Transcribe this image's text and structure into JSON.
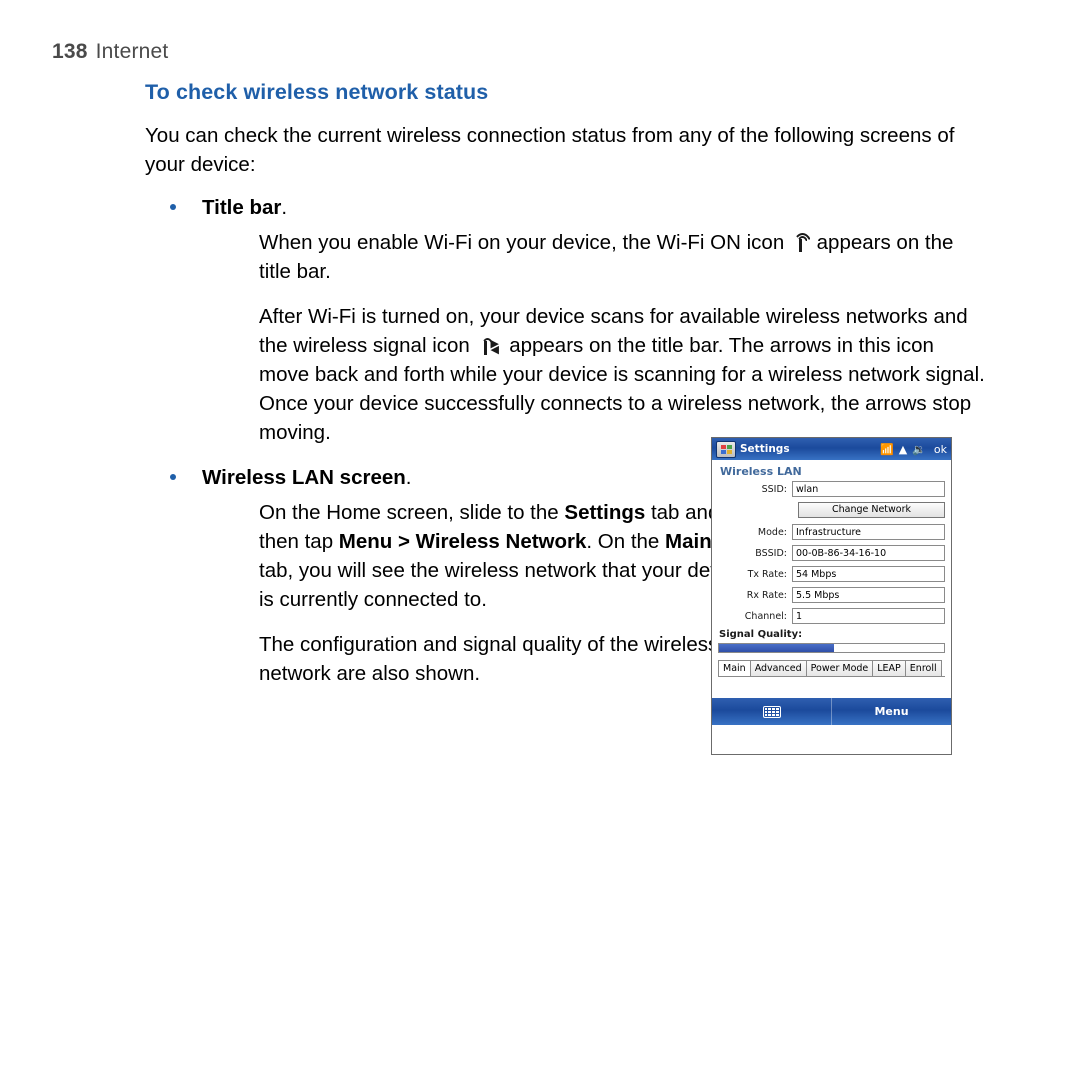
{
  "header": {
    "page_number": "138",
    "chapter": "Internet"
  },
  "section": {
    "title": "To check wireless network status",
    "intro": "You can check the current wireless connection status from any of the following screens of your device:"
  },
  "bullets": [
    {
      "head_bold": "Title bar",
      "head_rest": ".",
      "paragraphs": [
        "When you enable Wi-Fi on your device, the Wi-Fi ON icon  appears on the title bar.",
        "After Wi-Fi is turned on, your device scans for available wireless networks and the wireless signal icon  appears on the title bar. The arrows in this icon move back and forth while your device is scanning for a wireless network signal. Once your device successfully connects to a wireless network, the arrows stop moving."
      ]
    },
    {
      "head_bold": "Wireless LAN screen",
      "head_rest": ".",
      "paragraphs": [
        "On the Home screen, slide to the Settings tab and then tap Menu > Wireless Network. On the Main tab, you will see the wireless network that your device is currently connected to.",
        "The configuration and signal quality of the wireless network are also shown."
      ]
    }
  ],
  "para2_parts": {
    "p1a": "When you enable Wi-Fi on your device, the Wi-Fi ON icon",
    "p1b": "appears on the title bar.",
    "p2a": "After Wi-Fi is turned on, your device scans for available wireless networks and the wireless signal icon",
    "p2b": "appears on the title bar. The arrows in this icon move back and forth while your device is scanning for a wireless network signal. Once your device successfully connects to a wireless network, the arrows stop moving."
  },
  "para3_parts": {
    "a": "On the Home screen, slide to the ",
    "b": "Settings",
    "c": " tab and then tap ",
    "d": "Menu > Wireless Network",
    "e": ". On the ",
    "f": "Main",
    "g": " tab, you will see the wireless network that your device is currently connected to.",
    "h": "The configuration and signal quality of the wireless network are also shown."
  },
  "device": {
    "titlebar": {
      "app_title": "Settings",
      "ok_label": "ok"
    },
    "screen_title": "Wireless LAN",
    "fields": [
      {
        "label": "SSID:",
        "value": "wlan"
      },
      {
        "label": "Mode:",
        "value": "Infrastructure"
      },
      {
        "label": "BSSID:",
        "value": "00-0B-86-34-16-10"
      },
      {
        "label": "Tx Rate:",
        "value": "54 Mbps"
      },
      {
        "label": "Rx Rate:",
        "value": "5.5 Mbps"
      },
      {
        "label": "Channel:",
        "value": "1"
      }
    ],
    "change_network_button": "Change Network",
    "signal_quality_label": "Signal Quality:",
    "signal_quality_percent": 51,
    "tabs": [
      {
        "label": "Main",
        "active": true
      },
      {
        "label": "Advanced",
        "active": false
      },
      {
        "label": "Power Mode",
        "active": false
      },
      {
        "label": "LEAP",
        "active": false
      },
      {
        "label": "Enroll",
        "active": false
      }
    ],
    "softkeys": {
      "right_label": "Menu"
    }
  },
  "colors": {
    "heading_blue": "#1f5fa9",
    "titlebar_blue": "#1b4a9c",
    "screen_title_blue": "#41699b",
    "signal_fill": "#2f4fa8"
  }
}
